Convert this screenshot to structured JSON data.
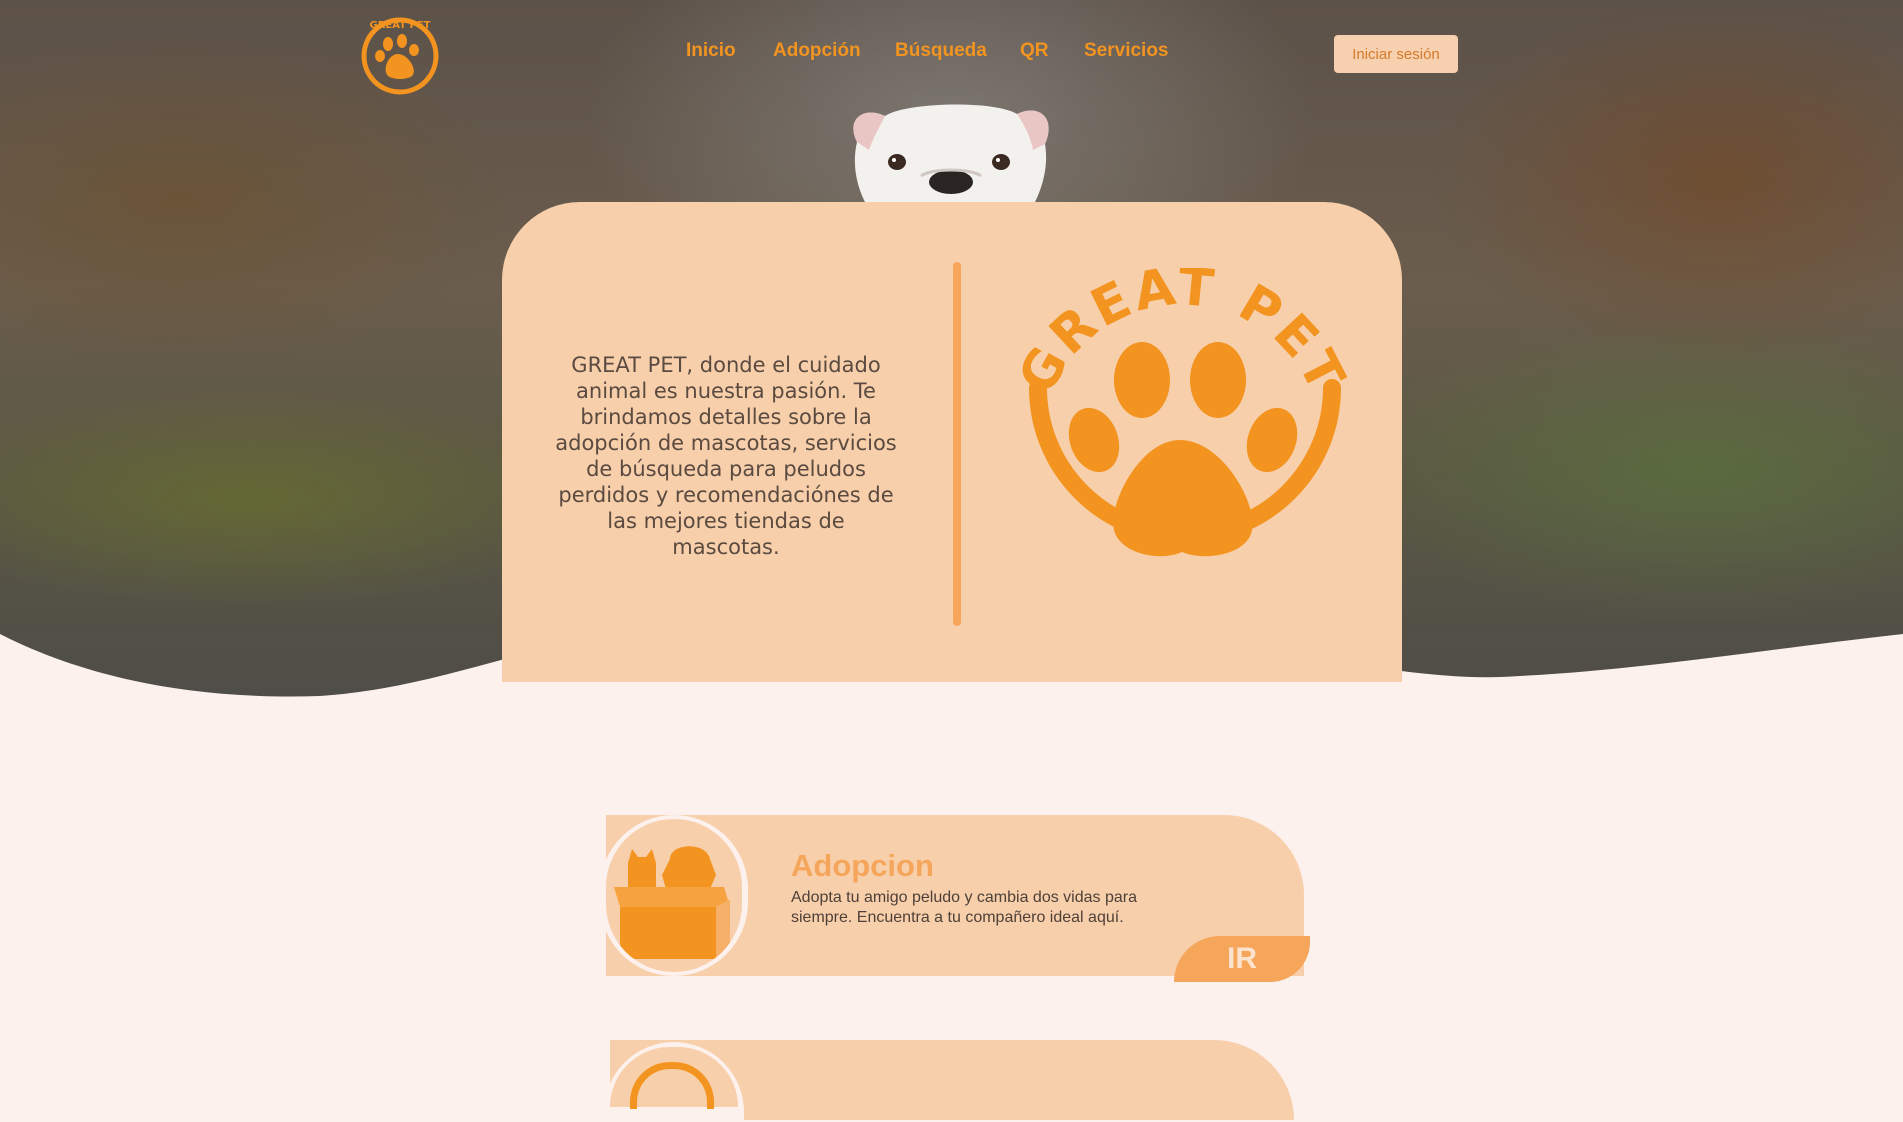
{
  "brand": {
    "name": "GREAT PET"
  },
  "nav": {
    "items": [
      {
        "label": "Inicio"
      },
      {
        "label": "Adopción"
      },
      {
        "label": "Búsqueda"
      },
      {
        "label": "QR"
      },
      {
        "label": "Servicios"
      }
    ],
    "login_label": "Iniciar sesión"
  },
  "hero": {
    "text": "GREAT PET, donde el cuidado animal es nuestra pasión. Te brindamos detalles sobre la adopción de mascotas, servicios de búsqueda para peludos perdidos y recomendaciónes de las mejores tiendas de mascotas.",
    "logo_text": "GREAT PET"
  },
  "services": [
    {
      "title": "Adopcion",
      "description": "Adopta tu amigo peludo y cambia dos vidas para siempre. Encuentra a tu compañero ideal aquí.",
      "button_label": "IR",
      "icon": "pets-in-box-icon"
    }
  ],
  "colors": {
    "accent": "#f2941f",
    "card": "#f8cfab",
    "background": "#fcf1ec",
    "soft_orange": "#f5a65b"
  }
}
